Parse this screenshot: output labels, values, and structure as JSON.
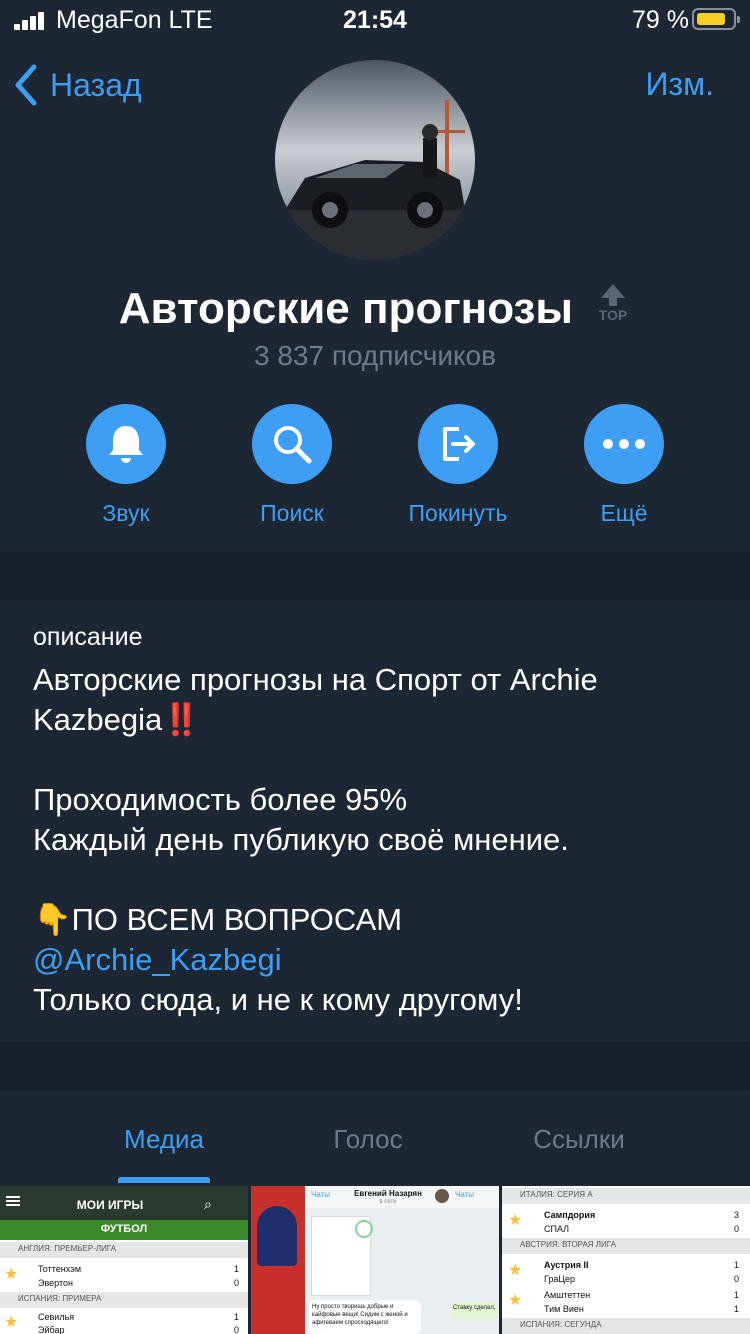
{
  "status_bar": {
    "carrier": "MegaFon  LTE",
    "time": "21:54",
    "battery": "79 %",
    "battery_level": 0.79
  },
  "nav": {
    "back_label": "Назад",
    "edit_label": "Изм."
  },
  "channel": {
    "title": "Авторские прогнозы",
    "badge": "TOP",
    "subscribers": "3 837 подписчиков"
  },
  "actions": [
    {
      "label": "Звук",
      "icon": "bell-icon"
    },
    {
      "label": "Поиск",
      "icon": "search-icon"
    },
    {
      "label": "Покинуть",
      "icon": "leave-icon"
    },
    {
      "label": "Ещё",
      "icon": "more-icon"
    }
  ],
  "description": {
    "label": "описание",
    "line1": "Авторские прогнозы на Спорт от Archie Kazbegia",
    "emoji1": "‼️",
    "line2": "Проходимость более 95%",
    "line3": "Каждый день публикую своё мнение.",
    "emoji2": "👇",
    "line4": "ПО ВСЕМ ВОПРОСАМ",
    "link": "@Archie_Kazbegi",
    "line5": "Только сюда, и не к кому другому!"
  },
  "tabs": [
    {
      "label": "Медиа",
      "active": true
    },
    {
      "label": "Голос",
      "active": false
    },
    {
      "label": "Ссылки",
      "active": false
    }
  ],
  "media": {
    "thumb1": {
      "header": "МОИ ИГРЫ",
      "sport": "ФУТБОЛ",
      "league1": "АНГЛИЯ: ПРЕМЬЕР-ЛИГА",
      "team1a": "Тоттенхэм",
      "score1a": "1",
      "team1b": "Эвертон",
      "score1b": "0",
      "league2": "ИСПАНИЯ: ПРИМЕРА",
      "team2a": "Севилья",
      "score2a": "1",
      "team2b": "Эйбар",
      "score2b": "0"
    },
    "thumb2": {
      "back_left": "Чаты",
      "name": "Евгений Назарян",
      "status": "в сети",
      "back_right": "Чаты",
      "msg_left": "Ну просто творишь добрые и кайфовые вещи! Сидим с женой и афигеваем спросходящего!",
      "msg_right": "Ставку сделал,"
    },
    "thumb3": {
      "league1": "ИТАЛИЯ: СЕРИЯ А",
      "team1a": "Сампдория",
      "score1a": "3",
      "team1b": "СПАЛ",
      "score1b": "0",
      "league2": "АВСТРИЯ: ВТОРАЯ ЛИГА",
      "team2a": "Аустрия II",
      "score2a": "1",
      "team2b": "ГраЦер",
      "score2b": "0",
      "team3a": "Амштеттен",
      "score3a": "1",
      "team3b": "Тим Виен",
      "score3b": "1",
      "league3": "ИСПАНИЯ: СЕГУНДА"
    }
  },
  "colors": {
    "background": "#1d2734",
    "accent": "#3e9ef3",
    "secondary_text": "#6d7a89",
    "battery": "#f6cf25"
  }
}
